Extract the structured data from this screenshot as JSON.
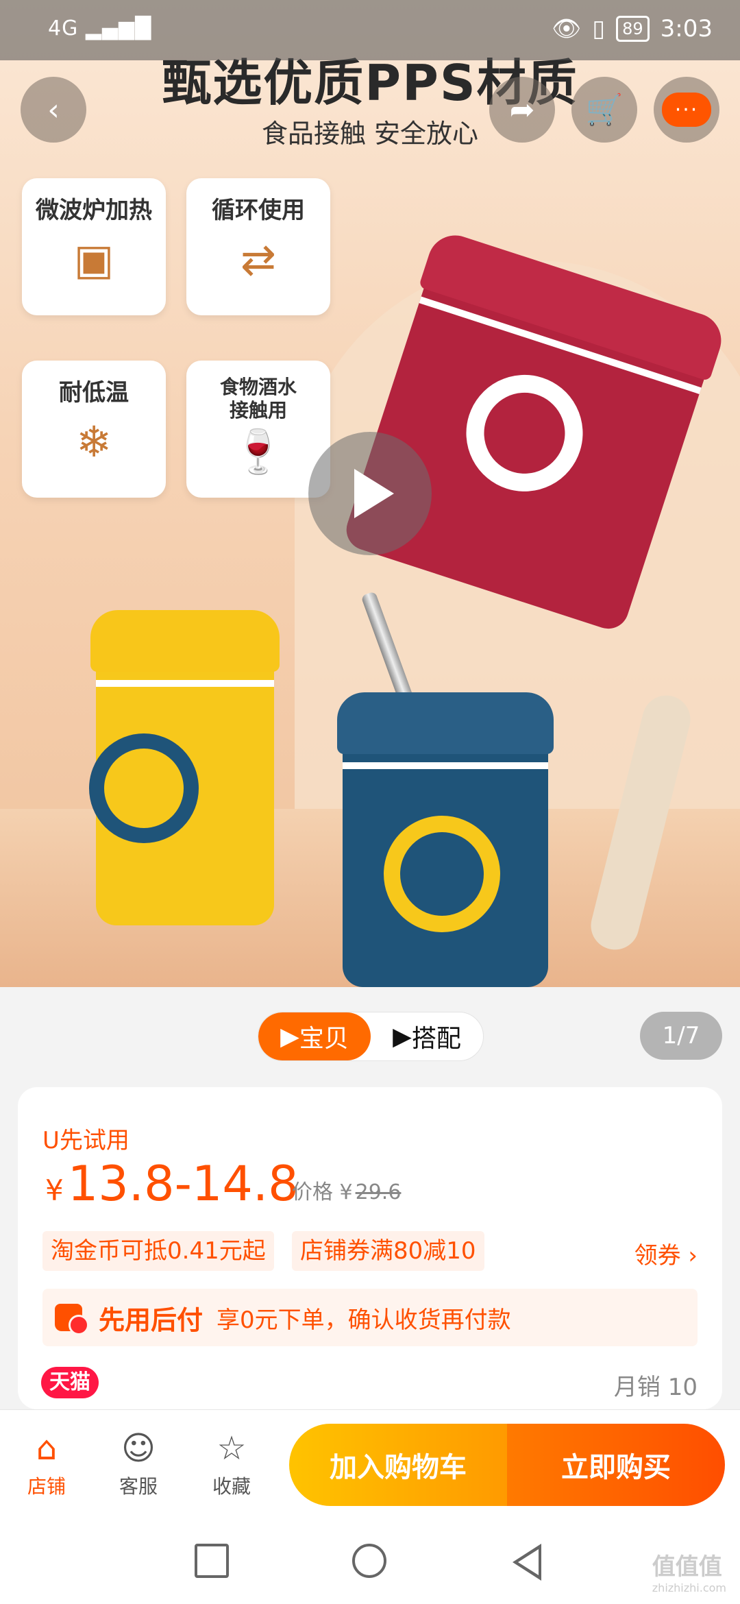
{
  "status_bar": {
    "network": "4G",
    "battery": "89",
    "time": "3:03"
  },
  "hero": {
    "headline": "甄选优质PPS材质",
    "subhead": "食品接触 安全放心",
    "features": [
      {
        "label": "微波炉加热",
        "icon": "microwave-icon"
      },
      {
        "label": "循环使用",
        "icon": "recycle-icon"
      },
      {
        "label": "耐低温",
        "icon": "snowflake-icon"
      },
      {
        "label": "食物酒水\n接触用",
        "icon": "bottle-glass-icon"
      }
    ],
    "more_label": "···"
  },
  "media": {
    "tab_active": "宝贝",
    "tab_other": "搭配",
    "counter": "1/7"
  },
  "product": {
    "trial": "U先试用",
    "currency": "¥",
    "price": "13.8-14.8",
    "orig_label": "价格 ¥",
    "orig_price": "29.6",
    "chips": [
      "淘金币可抵0.41元起",
      "店铺券满80减10"
    ],
    "coupon_link": "领券 ›",
    "payafter_title": "先用后付",
    "payafter_desc": "享0元下单，确认收货再付款",
    "badge": "天猫",
    "sales": "月销 10"
  },
  "bottom_bar": {
    "store": "店铺",
    "service": "客服",
    "favorite": "收藏",
    "add_to_cart": "加入购物车",
    "buy_now": "立即购买"
  },
  "watermark": {
    "text": "值值值",
    "sub": "zhizhizhi.com"
  },
  "colors": {
    "accent": "#ff5000",
    "cart_button": "#ffb300",
    "buy_button": "#ff5a00"
  }
}
